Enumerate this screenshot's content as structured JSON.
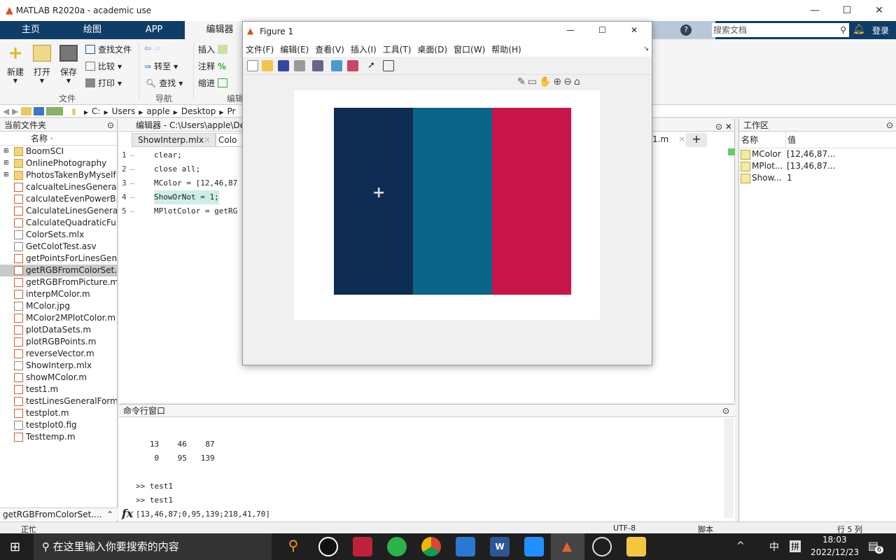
{
  "window": {
    "title": "MATLAB R2020a - academic use",
    "min": "—",
    "max": "☐",
    "close": "✕"
  },
  "ribbon_tabs": [
    {
      "label": "主页"
    },
    {
      "label": "绘图"
    },
    {
      "label": "APP"
    },
    {
      "label": "编辑器"
    }
  ],
  "search": {
    "placeholder": "搜索文档",
    "login": "登录"
  },
  "ribbon": {
    "new": "新建",
    "open": "打开",
    "save": "保存",
    "find_files": "查找文件",
    "compare": "比较",
    "print": "打印",
    "group_file": "文件",
    "goto": "转至",
    "find": "查找",
    "group_nav": "导航",
    "insert": "插入",
    "comment": "注释",
    "indent": "缩进",
    "group_edit": "编辑"
  },
  "address": [
    "C:",
    "Users",
    "apple",
    "Desktop",
    "Pr"
  ],
  "current_folder": {
    "title": "当前文件夹",
    "col_name": "名称",
    "selected_footer": "getRGBFromColorSet....",
    "files": [
      {
        "name": "BoomSCI",
        "type": "folder"
      },
      {
        "name": "OnlinePhotography",
        "type": "folder"
      },
      {
        "name": "PhotosTakenByMyself",
        "type": "folder"
      },
      {
        "name": "calcualteLinesGeneral...",
        "type": "m"
      },
      {
        "name": "calculateEvenPowerB...",
        "type": "m"
      },
      {
        "name": "CalculateLinesGeneral...",
        "type": "m"
      },
      {
        "name": "CalculateQuadraticFu...",
        "type": "m"
      },
      {
        "name": "ColorSets.mlx",
        "type": "mlx"
      },
      {
        "name": "GetColotTest.asv",
        "type": "file"
      },
      {
        "name": "getPointsForLinesGen...",
        "type": "m"
      },
      {
        "name": "getRGBFromColorSet...",
        "type": "m",
        "selected": true
      },
      {
        "name": "getRGBFromPicture.m",
        "type": "m"
      },
      {
        "name": "interpMColor.m",
        "type": "m"
      },
      {
        "name": "MColor.jpg",
        "type": "img"
      },
      {
        "name": "MColor2MPlotColor.m",
        "type": "m"
      },
      {
        "name": "plotDataSets.m",
        "type": "m"
      },
      {
        "name": "plotRGBPoints.m",
        "type": "m"
      },
      {
        "name": "reverseVector.m",
        "type": "m"
      },
      {
        "name": "ShowInterp.mlx",
        "type": "mlx"
      },
      {
        "name": "showMColor.m",
        "type": "m"
      },
      {
        "name": "test1.m",
        "type": "m"
      },
      {
        "name": "testLinesGeneralForm...",
        "type": "m"
      },
      {
        "name": "testplot.m",
        "type": "m"
      },
      {
        "name": "testplot0.fig",
        "type": "fig"
      },
      {
        "name": "Testtemp.m",
        "type": "m"
      }
    ]
  },
  "editor": {
    "title": "编辑器 - C:\\Users\\apple\\De",
    "tabs": [
      "ShowInterp.mlx",
      "Colo",
      "1.m"
    ],
    "lines": [
      {
        "n": "1",
        "code": "clear;"
      },
      {
        "n": "2",
        "code": "close all;"
      },
      {
        "n": "3",
        "code": "MColor = [12,46,87"
      },
      {
        "n": "4",
        "code": "ShowOrNot = 1;"
      },
      {
        "n": "5",
        "code": "MPlotColor = getRG"
      }
    ]
  },
  "command_window": {
    "title": "命令行窗口",
    "lines": [
      "   13    46    87",
      "    0    95   139",
      "",
      ">> test1",
      ">> test1"
    ],
    "input": "[13,46,87;0,95,139;218,41,70]",
    "fx": "fx"
  },
  "workspace": {
    "title": "工作区",
    "col_name": "名称",
    "col_value": "值",
    "vars": [
      {
        "name": "MColor",
        "value": "[12,46,87..."
      },
      {
        "name": "MPlot...",
        "value": "[13,46,87..."
      },
      {
        "name": "Show...",
        "value": "1"
      }
    ]
  },
  "status": {
    "left": "正忙",
    "encoding": "UTF-8",
    "type": "脚本",
    "position": "行 5   列"
  },
  "figure": {
    "title": "Figure 1",
    "menu": [
      "文件(F)",
      "编辑(E)",
      "查看(V)",
      "插入(I)",
      "工具(T)",
      "桌面(D)",
      "窗口(W)",
      "帮助(H)"
    ],
    "colors": [
      "#0f2d52",
      "#0b6589",
      "#c8154a"
    ]
  },
  "taskbar": {
    "search": "在这里输入你要搜索的内容",
    "time": "18:03",
    "date": "2022/12/23",
    "ime": "中",
    "ime2": "拼",
    "notifications": "6"
  }
}
